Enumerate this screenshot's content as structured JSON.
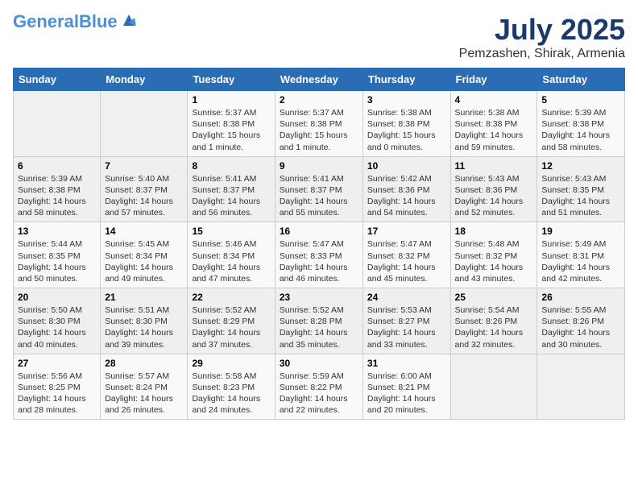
{
  "header": {
    "logo_general": "General",
    "logo_blue": "Blue",
    "title": "July 2025",
    "subtitle": "Pemzashen, Shirak, Armenia"
  },
  "columns": [
    "Sunday",
    "Monday",
    "Tuesday",
    "Wednesday",
    "Thursday",
    "Friday",
    "Saturday"
  ],
  "weeks": [
    [
      {
        "day": "",
        "info": ""
      },
      {
        "day": "",
        "info": ""
      },
      {
        "day": "1",
        "info": "Sunrise: 5:37 AM\nSunset: 8:38 PM\nDaylight: 15 hours and 1 minute."
      },
      {
        "day": "2",
        "info": "Sunrise: 5:37 AM\nSunset: 8:38 PM\nDaylight: 15 hours and 1 minute."
      },
      {
        "day": "3",
        "info": "Sunrise: 5:38 AM\nSunset: 8:38 PM\nDaylight: 15 hours and 0 minutes."
      },
      {
        "day": "4",
        "info": "Sunrise: 5:38 AM\nSunset: 8:38 PM\nDaylight: 14 hours and 59 minutes."
      },
      {
        "day": "5",
        "info": "Sunrise: 5:39 AM\nSunset: 8:38 PM\nDaylight: 14 hours and 58 minutes."
      }
    ],
    [
      {
        "day": "6",
        "info": "Sunrise: 5:39 AM\nSunset: 8:38 PM\nDaylight: 14 hours and 58 minutes."
      },
      {
        "day": "7",
        "info": "Sunrise: 5:40 AM\nSunset: 8:37 PM\nDaylight: 14 hours and 57 minutes."
      },
      {
        "day": "8",
        "info": "Sunrise: 5:41 AM\nSunset: 8:37 PM\nDaylight: 14 hours and 56 minutes."
      },
      {
        "day": "9",
        "info": "Sunrise: 5:41 AM\nSunset: 8:37 PM\nDaylight: 14 hours and 55 minutes."
      },
      {
        "day": "10",
        "info": "Sunrise: 5:42 AM\nSunset: 8:36 PM\nDaylight: 14 hours and 54 minutes."
      },
      {
        "day": "11",
        "info": "Sunrise: 5:43 AM\nSunset: 8:36 PM\nDaylight: 14 hours and 52 minutes."
      },
      {
        "day": "12",
        "info": "Sunrise: 5:43 AM\nSunset: 8:35 PM\nDaylight: 14 hours and 51 minutes."
      }
    ],
    [
      {
        "day": "13",
        "info": "Sunrise: 5:44 AM\nSunset: 8:35 PM\nDaylight: 14 hours and 50 minutes."
      },
      {
        "day": "14",
        "info": "Sunrise: 5:45 AM\nSunset: 8:34 PM\nDaylight: 14 hours and 49 minutes."
      },
      {
        "day": "15",
        "info": "Sunrise: 5:46 AM\nSunset: 8:34 PM\nDaylight: 14 hours and 47 minutes."
      },
      {
        "day": "16",
        "info": "Sunrise: 5:47 AM\nSunset: 8:33 PM\nDaylight: 14 hours and 46 minutes."
      },
      {
        "day": "17",
        "info": "Sunrise: 5:47 AM\nSunset: 8:32 PM\nDaylight: 14 hours and 45 minutes."
      },
      {
        "day": "18",
        "info": "Sunrise: 5:48 AM\nSunset: 8:32 PM\nDaylight: 14 hours and 43 minutes."
      },
      {
        "day": "19",
        "info": "Sunrise: 5:49 AM\nSunset: 8:31 PM\nDaylight: 14 hours and 42 minutes."
      }
    ],
    [
      {
        "day": "20",
        "info": "Sunrise: 5:50 AM\nSunset: 8:30 PM\nDaylight: 14 hours and 40 minutes."
      },
      {
        "day": "21",
        "info": "Sunrise: 5:51 AM\nSunset: 8:30 PM\nDaylight: 14 hours and 39 minutes."
      },
      {
        "day": "22",
        "info": "Sunrise: 5:52 AM\nSunset: 8:29 PM\nDaylight: 14 hours and 37 minutes."
      },
      {
        "day": "23",
        "info": "Sunrise: 5:52 AM\nSunset: 8:28 PM\nDaylight: 14 hours and 35 minutes."
      },
      {
        "day": "24",
        "info": "Sunrise: 5:53 AM\nSunset: 8:27 PM\nDaylight: 14 hours and 33 minutes."
      },
      {
        "day": "25",
        "info": "Sunrise: 5:54 AM\nSunset: 8:26 PM\nDaylight: 14 hours and 32 minutes."
      },
      {
        "day": "26",
        "info": "Sunrise: 5:55 AM\nSunset: 8:26 PM\nDaylight: 14 hours and 30 minutes."
      }
    ],
    [
      {
        "day": "27",
        "info": "Sunrise: 5:56 AM\nSunset: 8:25 PM\nDaylight: 14 hours and 28 minutes."
      },
      {
        "day": "28",
        "info": "Sunrise: 5:57 AM\nSunset: 8:24 PM\nDaylight: 14 hours and 26 minutes."
      },
      {
        "day": "29",
        "info": "Sunrise: 5:58 AM\nSunset: 8:23 PM\nDaylight: 14 hours and 24 minutes."
      },
      {
        "day": "30",
        "info": "Sunrise: 5:59 AM\nSunset: 8:22 PM\nDaylight: 14 hours and 22 minutes."
      },
      {
        "day": "31",
        "info": "Sunrise: 6:00 AM\nSunset: 8:21 PM\nDaylight: 14 hours and 20 minutes."
      },
      {
        "day": "",
        "info": ""
      },
      {
        "day": "",
        "info": ""
      }
    ]
  ]
}
